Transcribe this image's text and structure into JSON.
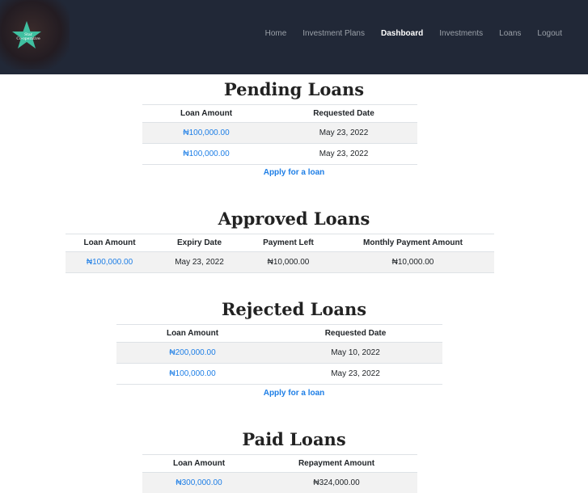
{
  "brand": {
    "logo_text_line1": "Star",
    "logo_text_line2": "Co-operative",
    "star_color": "#3fbfa0",
    "nav_background": "#212837"
  },
  "nav": {
    "items": [
      {
        "label": "Home"
      },
      {
        "label": "Investment Plans"
      },
      {
        "label": "Dashboard",
        "active": true
      },
      {
        "label": "Investments"
      },
      {
        "label": "Loans"
      },
      {
        "label": "Logout"
      }
    ]
  },
  "pending": {
    "title": "Pending Loans",
    "headers": [
      "Loan Amount",
      "Requested Date"
    ],
    "rows": [
      [
        "₦100,000.00",
        "May 23, 2022"
      ],
      [
        "₦100,000.00",
        "May 23, 2022"
      ]
    ],
    "apply_label": "Apply for a loan"
  },
  "approved": {
    "title": "Approved Loans",
    "headers": [
      "Loan Amount",
      "Expiry Date",
      "Payment Left",
      "Monthly Payment Amount"
    ],
    "rows": [
      [
        "₦100,000.00",
        "May 23, 2022",
        "₦10,000.00",
        "₦10,000.00"
      ]
    ]
  },
  "rejected": {
    "title": "Rejected Loans",
    "headers": [
      "Loan Amount",
      "Requested Date"
    ],
    "rows": [
      [
        "₦200,000.00",
        "May 10, 2022"
      ],
      [
        "₦100,000.00",
        "May 23, 2022"
      ]
    ],
    "apply_label": "Apply for a loan"
  },
  "paid": {
    "title": "Paid Loans",
    "headers": [
      "Loan Amount",
      "Repayment Amount"
    ],
    "rows": [
      [
        "₦300,000.00",
        "₦324,000.00"
      ]
    ]
  },
  "colors": {
    "link": "#1d7ee6",
    "stripe": "#f2f2f2"
  }
}
